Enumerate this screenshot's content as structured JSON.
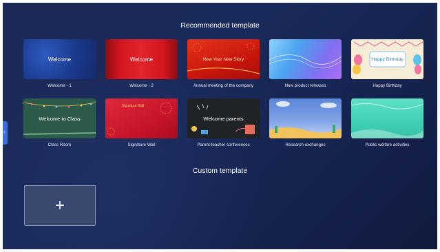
{
  "sections": {
    "recommended_title": "Recommended template",
    "custom_title": "Custom template"
  },
  "side_tab": {
    "icon": "chevron-right-icon",
    "glyph": "›"
  },
  "templates": [
    {
      "caption": "Welcome - 1",
      "thumb_title": "Welcome",
      "thumb_sub": "",
      "bg": "#1d3f8f"
    },
    {
      "caption": "Welcome - 2",
      "thumb_title": "Welcome",
      "thumb_sub": "",
      "bg": "#c4161c"
    },
    {
      "caption": "Annual meeting of the company",
      "thumb_title": "New Year New Story",
      "thumb_sub": "",
      "bg": "#d0200f"
    },
    {
      "caption": "New product releases",
      "thumb_title": "",
      "thumb_sub": "",
      "bg": "#5aa7f2"
    },
    {
      "caption": "Happy Birthday",
      "thumb_title": "Happy Birthday",
      "thumb_sub": "",
      "bg": "#f6ecd9"
    },
    {
      "caption": "Class Room",
      "thumb_title": "Welcome to Class",
      "thumb_sub": "",
      "bg": "#2c5a4a"
    },
    {
      "caption": "Signature Wall",
      "thumb_title": "Signature Wall",
      "thumb_sub": "",
      "bg": "#c9152a"
    },
    {
      "caption": "Parent-teacher conferences",
      "thumb_title": "Welcome parents",
      "thumb_sub": "",
      "bg": "#1f2326"
    },
    {
      "caption": "Research exchanges",
      "thumb_title": "",
      "thumb_sub": "",
      "bg": "#5d86d6"
    },
    {
      "caption": "Public welfare activities",
      "thumb_title": "",
      "thumb_sub": "",
      "bg": "#3fd0b5"
    }
  ],
  "custom": {
    "add_icon": "plus-icon",
    "add_glyph": "+"
  }
}
